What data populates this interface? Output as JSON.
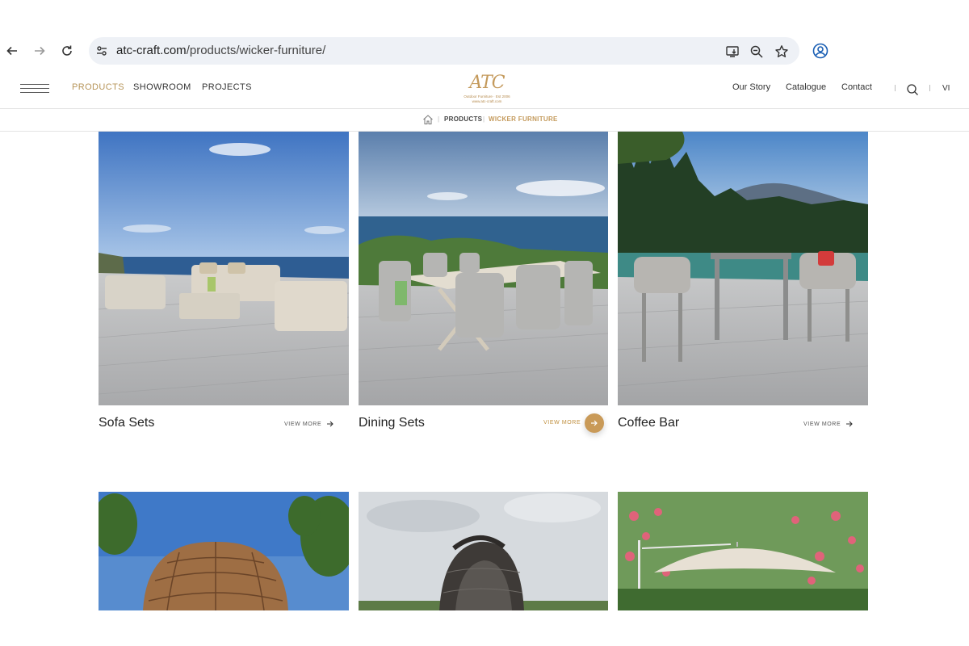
{
  "browser": {
    "url_host": "atc-craft.com",
    "url_path": "/products/wicker-furniture/"
  },
  "logo": {
    "mark": "ATC",
    "tagline": "Outdoor Furniture · Est 2006",
    "site": "www.atc-craft.com"
  },
  "main_nav": [
    {
      "label": "PRODUCTS",
      "active": true
    },
    {
      "label": "SHOWROOM",
      "active": false
    },
    {
      "label": "PROJECTS",
      "active": false
    }
  ],
  "right_nav": [
    {
      "label": "Our Story"
    },
    {
      "label": "Catalogue"
    },
    {
      "label": "Contact"
    }
  ],
  "language": "VI",
  "breadcrumb": [
    {
      "label": "PRODUCTS"
    },
    {
      "label": "WICKER FURNITURE"
    }
  ],
  "products": [
    {
      "title": "Sofa Sets",
      "cta": "VIEW MORE",
      "hovered": false
    },
    {
      "title": "Dining Sets",
      "cta": "VIEW MORE",
      "hovered": true
    },
    {
      "title": "Coffee Bar",
      "cta": "VIEW MORE",
      "hovered": false
    }
  ],
  "colors": {
    "accent": "#b7955a",
    "accent_button": "#c99a58"
  },
  "icons": {
    "back": "arrow-left-icon",
    "forward": "arrow-right-icon",
    "reload": "reload-icon",
    "site_settings": "tune-icon",
    "install": "install-icon",
    "zoom": "zoom-icon",
    "bookmark": "star-icon",
    "profile": "profile-icon",
    "search": "search-icon",
    "home": "home-icon"
  }
}
